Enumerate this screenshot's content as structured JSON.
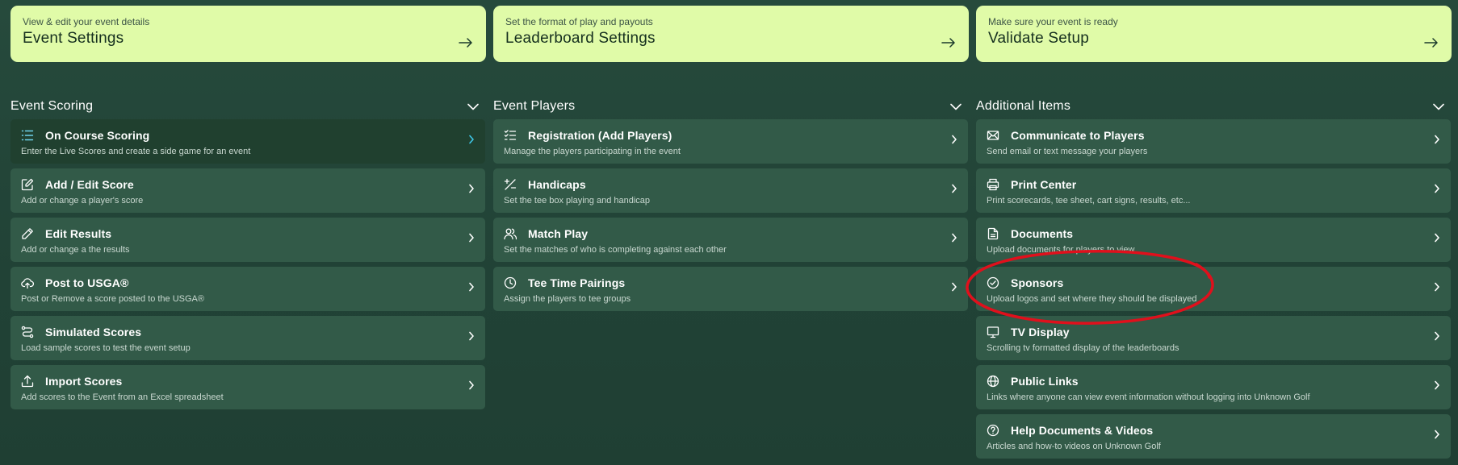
{
  "top_cards": [
    {
      "subtitle": "View & edit your event details",
      "title": "Event Settings"
    },
    {
      "subtitle": "Set the format of play and payouts",
      "title": "Leaderboard Settings"
    },
    {
      "subtitle": "Make sure your event is ready",
      "title": "Validate Setup"
    }
  ],
  "columns": [
    {
      "title": "Event Scoring",
      "items": [
        {
          "label": "On Course Scoring",
          "desc": "Enter the Live Scores and create a side game for an event",
          "icon": "list-icon",
          "active": true
        },
        {
          "label": "Add / Edit Score",
          "desc": "Add or change a player's score",
          "icon": "edit-square-icon"
        },
        {
          "label": "Edit Results",
          "desc": "Add or change a the results",
          "icon": "pencil-icon"
        },
        {
          "label": "Post to USGA®",
          "desc": "Post or Remove a score posted to the USGA®",
          "icon": "cloud-upload-icon"
        },
        {
          "label": "Simulated Scores",
          "desc": "Load sample scores to test the event setup",
          "icon": "route-icon"
        },
        {
          "label": "Import Scores",
          "desc": "Add scores to the Event from an Excel spreadsheet",
          "icon": "upload-icon"
        }
      ]
    },
    {
      "title": "Event Players",
      "items": [
        {
          "label": "Registration (Add Players)",
          "desc": "Manage the players participating in the event",
          "icon": "checklist-icon"
        },
        {
          "label": "Handicaps",
          "desc": "Set the tee box playing and handicap",
          "icon": "plus-minus-icon"
        },
        {
          "label": "Match Play",
          "desc": "Set the matches of who is completing against each other",
          "icon": "users-icon"
        },
        {
          "label": "Tee Time Pairings",
          "desc": "Assign the players to tee groups",
          "icon": "clock-icon"
        }
      ]
    },
    {
      "title": "Additional Items",
      "items": [
        {
          "label": "Communicate to Players",
          "desc": "Send email or text message your players",
          "icon": "mail-icon"
        },
        {
          "label": "Print Center",
          "desc": "Print scorecards, tee sheet, cart signs, results, etc...",
          "icon": "printer-icon"
        },
        {
          "label": "Documents",
          "desc": "Upload documents for players to view",
          "icon": "document-icon"
        },
        {
          "label": "Sponsors",
          "desc": "Upload logos and set where they should be displayed",
          "icon": "badge-check-icon"
        },
        {
          "label": "TV Display",
          "desc": "Scrolling tv formatted display of the leaderboards",
          "icon": "monitor-icon"
        },
        {
          "label": "Public Links",
          "desc": "Links where anyone can view event information without logging into Unknown Golf",
          "icon": "globe-icon"
        },
        {
          "label": "Help Documents & Videos",
          "desc": "Articles and how-to videos on Unknown Golf",
          "icon": "help-circle-icon"
        }
      ]
    }
  ],
  "colors": {
    "background": "#234538",
    "card_accent": "#e0fba8",
    "item_bg": "#325a48",
    "active_chevron": "#3ec7e8",
    "annotation": "#e0101c"
  }
}
